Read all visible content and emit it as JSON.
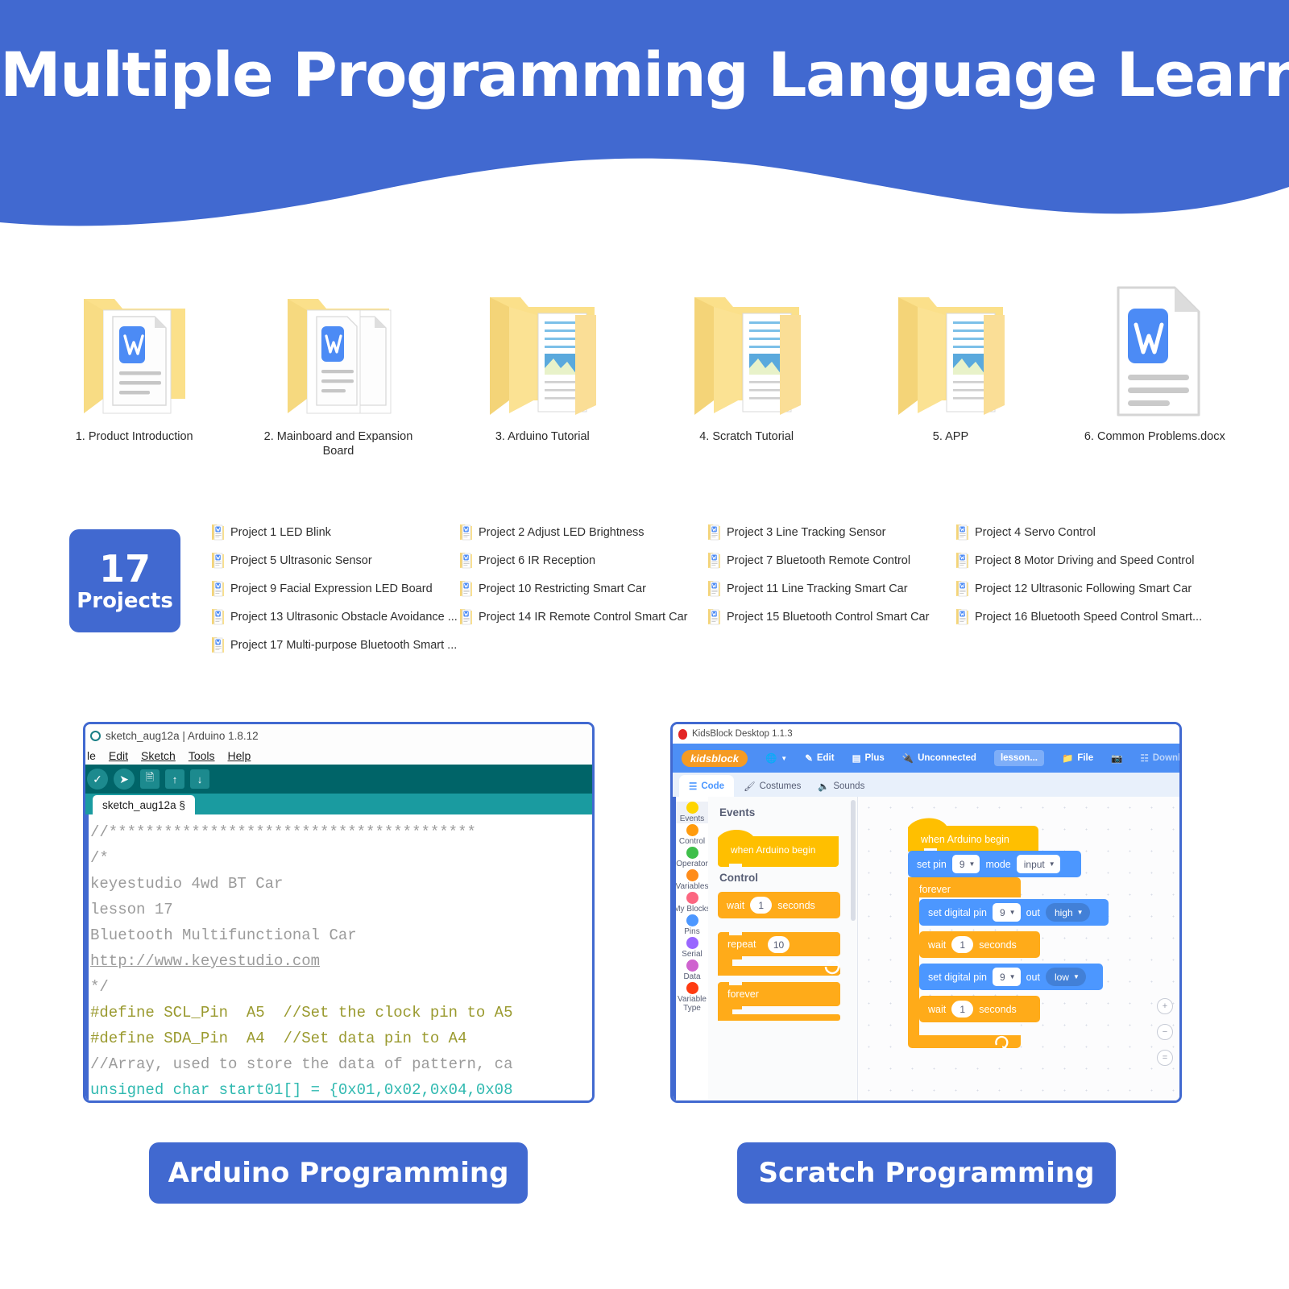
{
  "header": {
    "title": "Multiple Programming Language Learning",
    "bg_color": "#4169d0"
  },
  "folders": [
    {
      "label": "1. Product Introduction",
      "icon": "folder-with-doc-icon"
    },
    {
      "label": "2. Mainboard and Expansion Board",
      "icon": "folder-stack-with-doc-icon"
    },
    {
      "label": "3. Arduino Tutorial",
      "icon": "folder-with-pages-icon"
    },
    {
      "label": "4. Scratch Tutorial",
      "icon": "folder-with-pages-icon"
    },
    {
      "label": "5. APP",
      "icon": "folder-with-pages-icon"
    },
    {
      "label": "6. Common Problems.docx",
      "icon": "word-document-icon"
    }
  ],
  "projects_badge": {
    "count": "17",
    "word": "Projects",
    "color": "#4169d0"
  },
  "projects": [
    "Project 1 LED Blink",
    "Project 2 Adjust LED Brightness",
    "Project 3 Line Tracking Sensor",
    "Project 4 Servo Control",
    "Project 5 Ultrasonic Sensor",
    "Project 6 IR Reception",
    "Project 7 Bluetooth Remote Control",
    "Project 8 Motor Driving and Speed Control",
    "Project 9 Facial Expression LED Board",
    "Project 10 Restricting Smart Car",
    "Project 11 Line Tracking Smart Car",
    "Project 12 Ultrasonic Following Smart Car",
    "Project 13 Ultrasonic Obstacle Avoidance ...",
    "Project 14 IR Remote Control Smart Car",
    "Project 15 Bluetooth Control Smart Car",
    "Project 16 Bluetooth Speed Control Smart...",
    "Project 17 Multi-purpose Bluetooth Smart ..."
  ],
  "arduino": {
    "window_title": "sketch_aug12a | Arduino 1.8.12",
    "menu": [
      "le",
      "Edit",
      "Sketch",
      "Tools",
      "Help"
    ],
    "toolbar_icons": [
      "verify-icon",
      "upload-icon",
      "new-icon",
      "open-icon",
      "save-icon"
    ],
    "tab_label": "sketch_aug12a §",
    "code": [
      "//****************************************",
      "/*",
      "keyestudio 4wd BT Car",
      "lesson 17",
      "Bluetooth Multifunctional Car",
      "http://www.keyestudio.com",
      "*/",
      "#define SCL_Pin  A5  //Set the clock pin to A5",
      "#define SDA_Pin  A4  //Set data pin to A4",
      "//Array, used to store the data of pattern, ca",
      "unsigned char start01[] = {0x01,0x02,0x04,0x08"
    ]
  },
  "scratch": {
    "window_title": "KidsBlock Desktop 1.1.3",
    "logo": "kidsblock",
    "menubar": [
      {
        "label": "",
        "icon": "globe-icon",
        "caret": true
      },
      {
        "label": "Edit",
        "icon": "edit-icon"
      },
      {
        "label": "Plus",
        "icon": "plus-board-icon"
      },
      {
        "label": "Unconnected",
        "icon": "disconnected-icon"
      },
      {
        "label": "lesson...",
        "icon": "lesson-pill"
      },
      {
        "label": "File",
        "icon": "folder-icon"
      },
      {
        "label": "",
        "icon": "camera-icon"
      },
      {
        "label": "Download firmware",
        "icon": "chip-icon"
      }
    ],
    "tabs": [
      {
        "label": "Code",
        "icon": "code-icon",
        "active": true
      },
      {
        "label": "Costumes",
        "icon": "brush-icon",
        "active": false
      },
      {
        "label": "Sounds",
        "icon": "speaker-icon",
        "active": false
      }
    ],
    "categories": [
      {
        "label": "Events",
        "color": "#ffd500"
      },
      {
        "label": "Control",
        "color": "#ff9b0d"
      },
      {
        "label": "Operator",
        "color": "#3fbf4a"
      },
      {
        "label": "Variables",
        "color": "#ff8c1a"
      },
      {
        "label": "My Blocks",
        "color": "#fc6680"
      },
      {
        "label": "Pins",
        "color": "#4c97ff"
      },
      {
        "label": "Serial",
        "color": "#9966ff"
      },
      {
        "label": "Data",
        "color": "#cf63cf"
      },
      {
        "label": "Variable Type",
        "color": "#ff3b11"
      }
    ],
    "palette": {
      "section_events": "Events",
      "section_control": "Control",
      "block_hat": "when Arduino begin",
      "block_wait_prefix": "wait",
      "block_wait_value": "1",
      "block_wait_suffix": "seconds",
      "block_repeat_prefix": "repeat",
      "block_repeat_value": "10",
      "block_forever": "forever"
    },
    "script": {
      "hat": "when Arduino begin",
      "set_pin_prefix": "set pin",
      "set_pin_value": "9",
      "set_pin_mode_label": "mode",
      "set_pin_mode_value": "input",
      "forever": "forever",
      "set_digital_prefix": "set digital pin",
      "set_digital_value_1": "9",
      "set_digital_out_label": "out",
      "set_digital_out_value_1": "high",
      "wait_label": "wait",
      "wait_value_1": "1",
      "wait_unit_1": "seconds",
      "set_digital_value_2": "9",
      "set_digital_out_value_2": "low",
      "wait_value_2": "1",
      "wait_unit_2": "seconds"
    },
    "zoom_controls": [
      "zoom-in-icon",
      "zoom-out-icon",
      "zoom-reset-icon"
    ]
  },
  "cta": {
    "arduino": "Arduino Programming",
    "scratch": "Scratch Programming"
  }
}
